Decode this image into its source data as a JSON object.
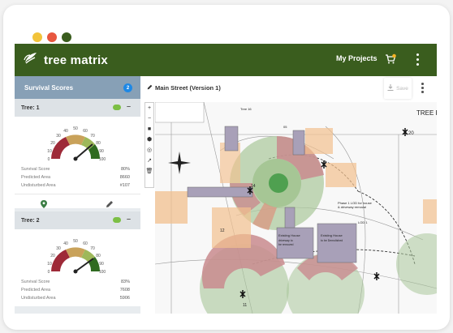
{
  "window": {
    "dot_colors": [
      "#f2c33a",
      "#e8573f",
      "#3a5d1e"
    ]
  },
  "topbar": {
    "brand": "tree matrix",
    "my_projects": "My Projects",
    "cart_badge_color": "#f5b324",
    "icons": [
      "tree-logo-icon",
      "cart-icon",
      "more-vertical-icon"
    ]
  },
  "sidebar": {
    "title": "Survival Scores",
    "count": "2",
    "trees": [
      {
        "name": "Tree: 1",
        "gauge_ticks": [
          "0",
          "10",
          "20",
          "30",
          "40",
          "50",
          "60",
          "70",
          "80",
          "90",
          "100"
        ],
        "needle_value": 80,
        "rows": [
          {
            "label": "Survival Score",
            "value": "80%"
          },
          {
            "label": "Predicted Area",
            "value": "8660"
          },
          {
            "label": "Undisturbed Area",
            "value": "#107"
          }
        ]
      },
      {
        "name": "Tree: 2",
        "gauge_ticks": [
          "0",
          "10",
          "20",
          "30",
          "40",
          "50",
          "60",
          "70",
          "80",
          "90",
          "100"
        ],
        "needle_value": 83,
        "rows": [
          {
            "label": "Survival Score",
            "value": "83%"
          },
          {
            "label": "Predicted Area",
            "value": "7608"
          },
          {
            "label": "Undisturbed Area",
            "value": "5906"
          }
        ]
      }
    ]
  },
  "map": {
    "title": "Main Street (Version 1)",
    "save_label": "Save",
    "tools": [
      "+",
      "−",
      "■",
      "⬢",
      "◎",
      "↗",
      "🗑"
    ],
    "plan_labels": {
      "tree16": "Tree 16",
      "title_right": "TREE P",
      "existing_house_top": "Existing House",
      "existing_house_top2": "driveway to",
      "existing_house_top3": "be removed",
      "existing_house_right": "Existing House",
      "existing_house_right2": "to be Demolished",
      "note": "Phase 1 LOD for house",
      "note2": "& driveway removal",
      "lod": "LOD 1",
      "tree_num_14": "14",
      "tree_num_20": "20",
      "tree_num_05": "05",
      "tree_num_12": "12",
      "tree_num_11": "11"
    }
  }
}
